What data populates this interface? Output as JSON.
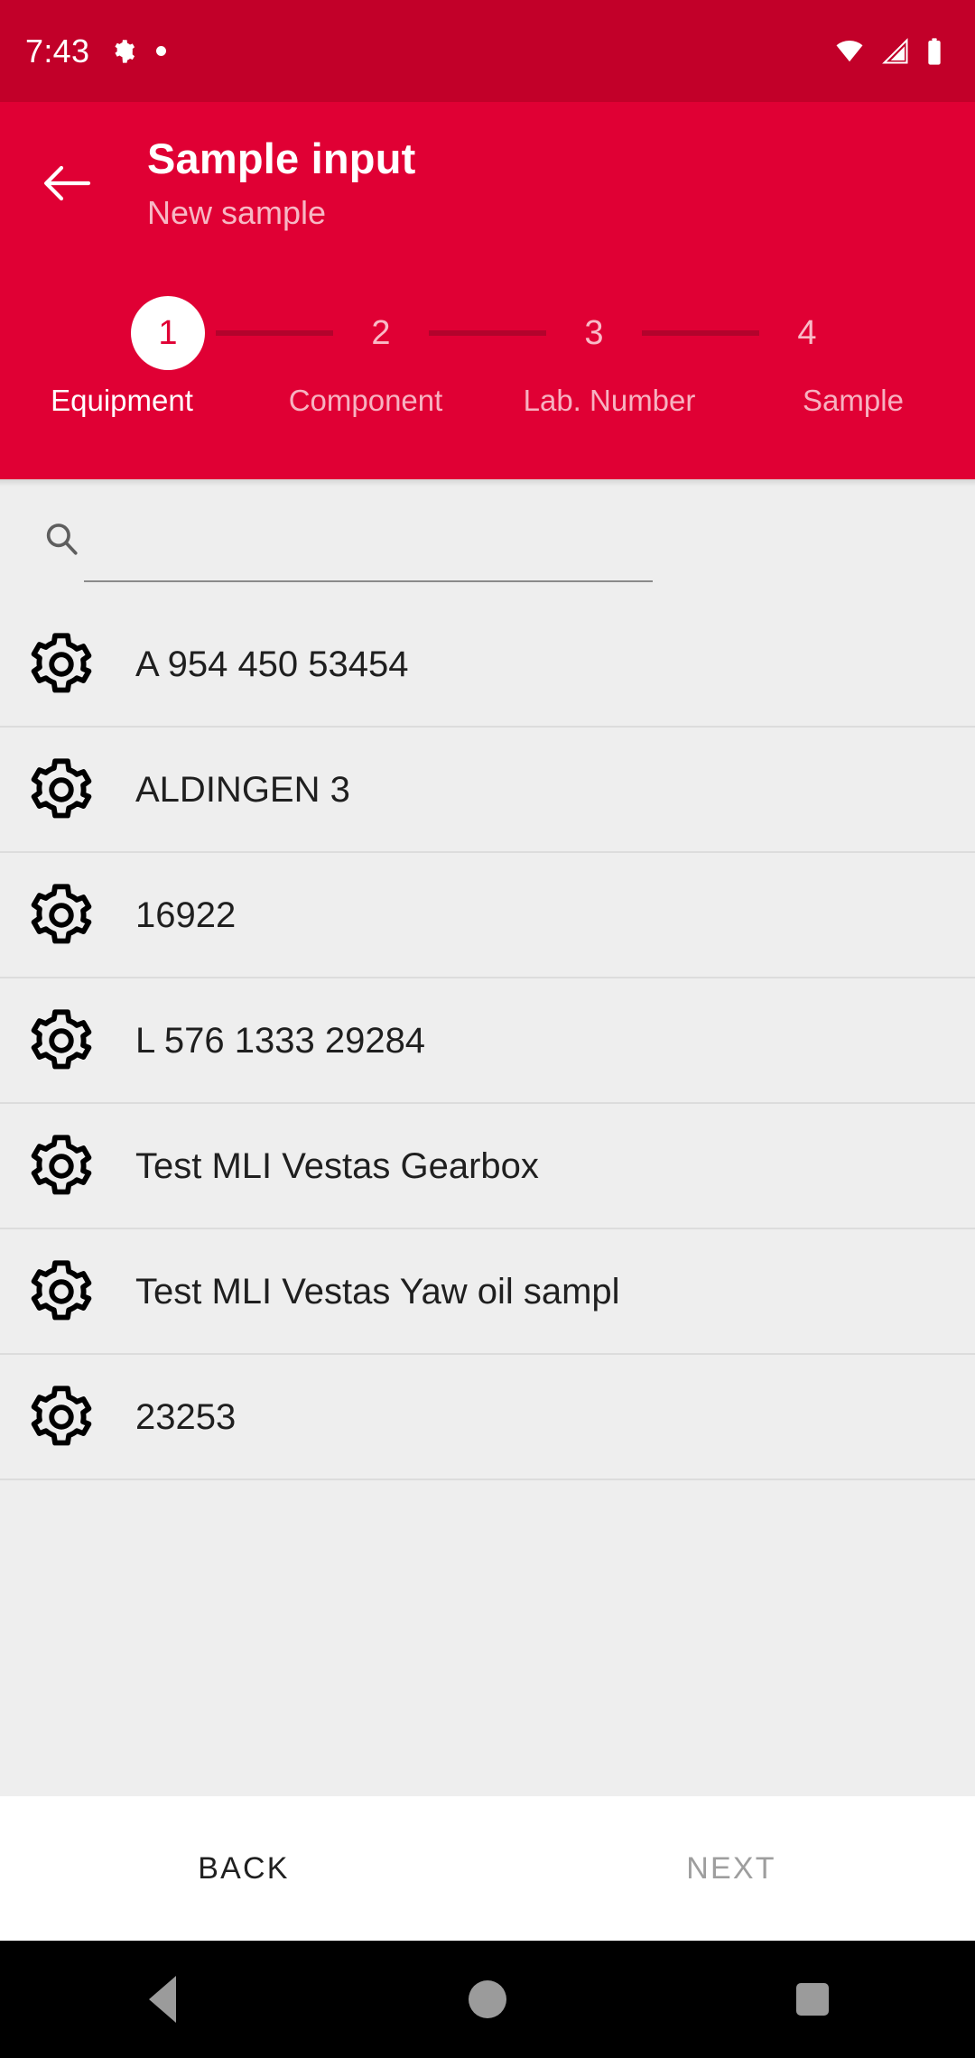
{
  "status_bar": {
    "time": "7:43",
    "left_icons": [
      "gear-icon",
      "dot-indicator"
    ],
    "right_icons": [
      "wifi-icon",
      "cellular-signal-icon",
      "battery-icon"
    ],
    "background_color": "#c20029"
  },
  "app_bar": {
    "back_icon": "arrow-left-icon",
    "title": "Sample input",
    "subtitle": "New sample",
    "background_color": "#e00034",
    "accent_color": "#e00034"
  },
  "stepper": {
    "current_step": 1,
    "steps": [
      {
        "number": "1",
        "label": "Equipment",
        "active": true
      },
      {
        "number": "2",
        "label": "Component",
        "active": false
      },
      {
        "number": "3",
        "label": "Lab. Number",
        "active": false
      },
      {
        "number": "4",
        "label": "Sample",
        "active": false
      }
    ]
  },
  "search": {
    "icon": "search-icon",
    "value": "",
    "placeholder": ""
  },
  "equipment_list": {
    "row_icon": "gear-icon",
    "items": [
      {
        "label": "A 954 450 53454"
      },
      {
        "label": "ALDINGEN 3"
      },
      {
        "label": "16922"
      },
      {
        "label": "L 576 1333 29284"
      },
      {
        "label": "Test MLI Vestas Gearbox"
      },
      {
        "label": "Test MLI Vestas Yaw oil sampl"
      },
      {
        "label": "23253"
      }
    ]
  },
  "footer": {
    "back_label": "BACK",
    "next_label": "NEXT",
    "back_enabled": true,
    "next_enabled": false
  },
  "nav_bar": {
    "back_icon": "triangle-back-icon",
    "home_icon": "circle-home-icon",
    "recents_icon": "square-recents-icon"
  }
}
